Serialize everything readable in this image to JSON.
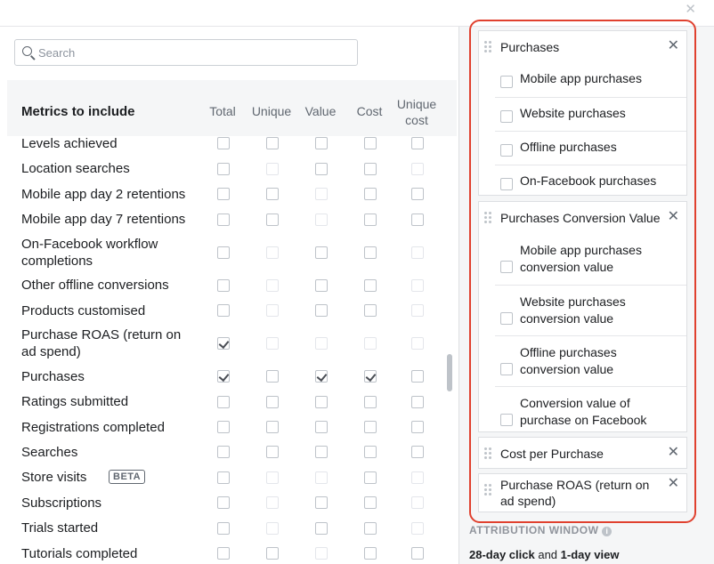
{
  "dialog": {
    "close_icon": "close-icon"
  },
  "search": {
    "placeholder": "Search"
  },
  "metrics": {
    "title": "Metrics to include",
    "columns": [
      "Total",
      "Unique",
      "Value",
      "Cost",
      "Unique cost"
    ],
    "rows": [
      {
        "label": "Levels achieved",
        "checks": [
          0,
          0,
          0,
          0,
          0
        ],
        "disabled": [
          0,
          0,
          0,
          0,
          0
        ]
      },
      {
        "label": "Location searches",
        "checks": [
          0,
          0,
          0,
          0,
          0
        ],
        "disabled": [
          0,
          1,
          0,
          0,
          1
        ]
      },
      {
        "label": "Mobile app day 2 retentions",
        "checks": [
          0,
          0,
          0,
          0,
          0
        ],
        "disabled": [
          0,
          0,
          1,
          0,
          0
        ]
      },
      {
        "label": "Mobile app day 7 retentions",
        "checks": [
          0,
          0,
          0,
          0,
          0
        ],
        "disabled": [
          0,
          0,
          1,
          0,
          0
        ]
      },
      {
        "label": "On-Facebook workflow completions",
        "checks": [
          0,
          0,
          0,
          0,
          0
        ],
        "disabled": [
          0,
          1,
          0,
          0,
          1
        ]
      },
      {
        "label": "Other offline conversions",
        "checks": [
          0,
          0,
          0,
          0,
          0
        ],
        "disabled": [
          0,
          1,
          0,
          0,
          1
        ]
      },
      {
        "label": "Products customised",
        "checks": [
          0,
          0,
          0,
          0,
          0
        ],
        "disabled": [
          0,
          1,
          0,
          0,
          1
        ]
      },
      {
        "label": "Purchase ROAS (return on ad spend)",
        "checks": [
          1,
          0,
          0,
          0,
          0
        ],
        "disabled": [
          0,
          1,
          1,
          1,
          1
        ]
      },
      {
        "label": "Purchases",
        "checks": [
          1,
          0,
          1,
          1,
          0
        ],
        "disabled": [
          0,
          0,
          0,
          0,
          0
        ]
      },
      {
        "label": "Ratings submitted",
        "checks": [
          0,
          0,
          0,
          0,
          0
        ],
        "disabled": [
          0,
          0,
          0,
          0,
          0
        ]
      },
      {
        "label": "Registrations completed",
        "checks": [
          0,
          0,
          0,
          0,
          0
        ],
        "disabled": [
          0,
          0,
          0,
          0,
          0
        ]
      },
      {
        "label": "Searches",
        "checks": [
          0,
          0,
          0,
          0,
          0
        ],
        "disabled": [
          0,
          0,
          0,
          0,
          0
        ]
      },
      {
        "label": "Store visits",
        "badge": "BETA",
        "checks": [
          0,
          0,
          0,
          0,
          0
        ],
        "disabled": [
          0,
          1,
          1,
          0,
          1
        ]
      },
      {
        "label": "Subscriptions",
        "checks": [
          0,
          0,
          0,
          0,
          0
        ],
        "disabled": [
          0,
          1,
          0,
          0,
          1
        ]
      },
      {
        "label": "Trials started",
        "checks": [
          0,
          0,
          0,
          0,
          0
        ],
        "disabled": [
          0,
          1,
          0,
          0,
          1
        ]
      },
      {
        "label": "Tutorials completed",
        "checks": [
          0,
          0,
          0,
          0,
          0
        ],
        "disabled": [
          0,
          0,
          1,
          0,
          0
        ]
      }
    ]
  },
  "selected": {
    "cards": [
      {
        "title": "Purchases",
        "subs": [
          "Mobile app purchases",
          "Website purchases",
          "Offline purchases",
          "On-Facebook purchases"
        ]
      },
      {
        "title": "Purchases Conversion Value",
        "subs": [
          "Mobile app purchases conversion value",
          "Website purchases conversion value",
          "Offline purchases conversion value",
          "Conversion value of purchase on Facebook"
        ]
      },
      {
        "title": "Cost per Purchase",
        "subs": []
      },
      {
        "title": "Purchase ROAS (return on ad spend)",
        "subs": []
      }
    ]
  },
  "attribution": {
    "heading": "ATTRIBUTION WINDOW",
    "click_value": "28-day click",
    "joiner": "and",
    "view_value": "1-day view"
  },
  "colors": {
    "highlight": "#e0412f",
    "panel": "#f5f6f7"
  }
}
